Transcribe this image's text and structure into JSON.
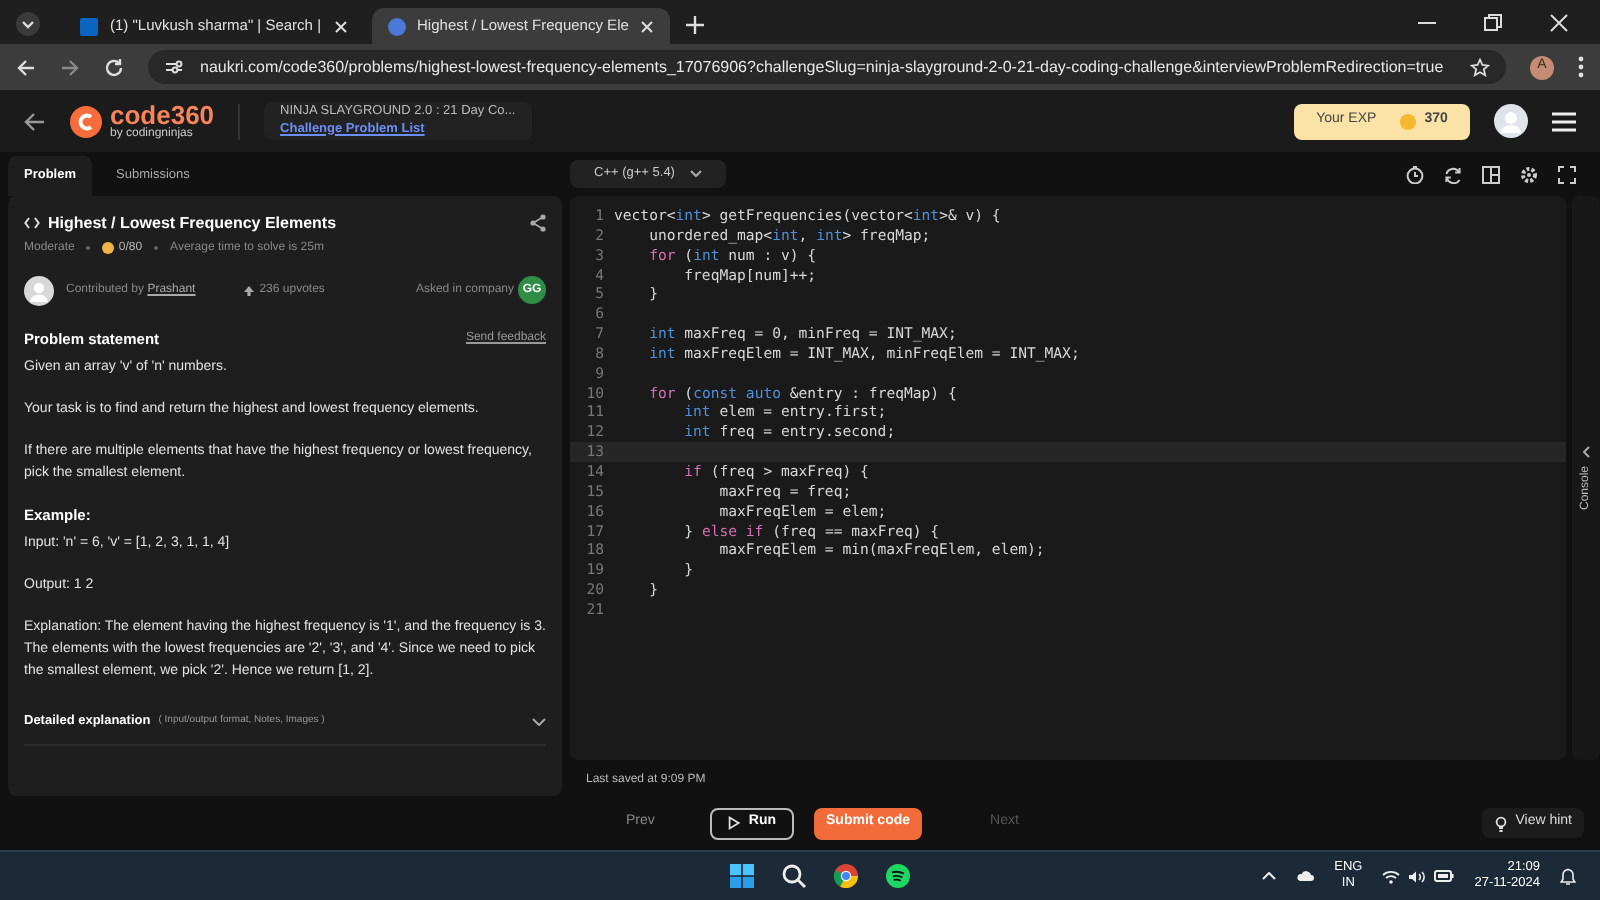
{
  "browser": {
    "tabs": [
      {
        "label": "(1) \"Luvkush sharma\" | Search |",
        "selected": false
      },
      {
        "label": "Highest / Lowest Frequency Ele",
        "selected": true
      }
    ],
    "url": "naukri.com/code360/problems/highest-lowest-frequency-elements_17076906?challengeSlug=ninja-slayground-2-0-21-day-coding-challenge&interviewProblemRedirection=true",
    "profile": "A"
  },
  "header": {
    "logo": "code360",
    "logo_sub": "by codingninjas",
    "contest": "NINJA SLAYGROUND 2.0 : 21 Day Co...",
    "contest_link": "Challenge Problem List",
    "exp_label": "Your EXP",
    "exp_value": "370"
  },
  "panel_tabs": [
    {
      "label": "Problem",
      "selected": true
    },
    {
      "label": "Submissions",
      "selected": false
    }
  ],
  "problem": {
    "title": "Highest / Lowest Frequency Elements",
    "difficulty": "Moderate",
    "score": "0/80",
    "avg_time": "Average time to solve is 25m",
    "contributed_by": "Contributed by",
    "contributor": "Prashant",
    "upvotes": "236 upvotes",
    "asked_in": "Asked in company",
    "company_badge": "GG",
    "statement_heading": "Problem statement",
    "feedback": "Send feedback",
    "paragraphs": [
      "Given an array 'v' of 'n' numbers.",
      "Your task is to find and return the highest and lowest frequency elements.",
      "If there are multiple elements that have the highest frequency or lowest frequency, pick the smallest element."
    ],
    "example_heading": "Example:",
    "example_lines": [
      "Input: 'n' = 6, 'v' = [1, 2, 3, 1, 1, 4]",
      "Output: 1 2",
      "Explanation: The element having the highest frequency is '1', and the frequency is 3. The elements with the lowest frequencies are '2', '3', and '4'. Since we need to pick the smallest element, we pick '2'. Hence we return [1, 2]."
    ],
    "detail_heading": "Detailed explanation",
    "detail_note": "( Input/output format, Notes, Images )"
  },
  "editor": {
    "language": "C++ (g++ 5.4)",
    "console": "Console",
    "last_saved": "Last saved at 9:09 PM",
    "lines": [
      {
        "number": "1",
        "current": false,
        "segments": [
          {
            "kind": "plain",
            "text": "vector<"
          },
          {
            "kind": "type",
            "text": "int"
          },
          {
            "kind": "plain",
            "text": "> getFrequencies(vector<"
          },
          {
            "kind": "type",
            "text": "int"
          },
          {
            "kind": "plain",
            "text": ">& v) {"
          }
        ]
      },
      {
        "number": "2",
        "current": false,
        "segments": [
          {
            "kind": "plain",
            "text": "    unordered_map<"
          },
          {
            "kind": "type",
            "text": "int"
          },
          {
            "kind": "plain",
            "text": ", "
          },
          {
            "kind": "type",
            "text": "int"
          },
          {
            "kind": "plain",
            "text": "> freqMap;"
          }
        ]
      },
      {
        "number": "3",
        "current": false,
        "segments": [
          {
            "kind": "ctrl",
            "text": "    for"
          },
          {
            "kind": "plain",
            "text": " ("
          },
          {
            "kind": "type",
            "text": "int"
          },
          {
            "kind": "plain",
            "text": " num : v) {"
          }
        ]
      },
      {
        "number": "4",
        "current": false,
        "segments": [
          {
            "kind": "plain",
            "text": "        freqMap[num]++;"
          }
        ]
      },
      {
        "number": "5",
        "current": false,
        "segments": [
          {
            "kind": "plain",
            "text": "    }"
          }
        ]
      },
      {
        "number": "6",
        "current": false
      },
      {
        "number": "7",
        "current": false,
        "segments": [
          {
            "kind": "type",
            "text": "    int"
          },
          {
            "kind": "plain",
            "text": " maxFreq = 0, minFreq = INT_MAX;"
          }
        ]
      },
      {
        "number": "8",
        "current": false,
        "segments": [
          {
            "kind": "type",
            "text": "    int"
          },
          {
            "kind": "plain",
            "text": " maxFreqElem = INT_MAX, minFreqElem = INT_MAX;"
          }
        ]
      },
      {
        "number": "9",
        "current": false
      },
      {
        "number": "10",
        "current": false,
        "segments": [
          {
            "kind": "ctrl",
            "text": "    for"
          },
          {
            "kind": "plain",
            "text": " ("
          },
          {
            "kind": "type",
            "text": "const auto"
          },
          {
            "kind": "plain",
            "text": " &entry : freqMap) {"
          }
        ]
      },
      {
        "number": "11",
        "current": false,
        "segments": [
          {
            "kind": "type",
            "text": "        int"
          },
          {
            "kind": "plain",
            "text": " elem = entry.first;"
          }
        ]
      },
      {
        "number": "12",
        "current": false,
        "segments": [
          {
            "kind": "type",
            "text": "        int"
          },
          {
            "kind": "plain",
            "text": " freq = entry.second;"
          }
        ]
      },
      {
        "number": "13",
        "current": true
      },
      {
        "number": "14",
        "current": false,
        "segments": [
          {
            "kind": "ctrl",
            "text": "        if"
          },
          {
            "kind": "plain",
            "text": " (freq > maxFreq) {"
          }
        ]
      },
      {
        "number": "15",
        "current": false,
        "segments": [
          {
            "kind": "plain",
            "text": "            maxFreq = freq;"
          }
        ]
      },
      {
        "number": "16",
        "current": false,
        "segments": [
          {
            "kind": "plain",
            "text": "            maxFreqElem = elem;"
          }
        ]
      },
      {
        "number": "17",
        "current": false,
        "segments": [
          {
            "kind": "plain",
            "text": "        } "
          },
          {
            "kind": "ctrl",
            "text": "else if"
          },
          {
            "kind": "plain",
            "text": " (freq == maxFreq) {"
          }
        ]
      },
      {
        "number": "18",
        "current": false,
        "segments": [
          {
            "kind": "plain",
            "text": "            maxFreqElem = min(maxFreqElem, elem);"
          }
        ]
      },
      {
        "number": "19",
        "current": false,
        "segments": [
          {
            "kind": "plain",
            "text": "        }"
          }
        ]
      },
      {
        "number": "20",
        "current": false,
        "segments": [
          {
            "kind": "plain",
            "text": "    }"
          }
        ]
      },
      {
        "number": "21",
        "current": false
      }
    ],
    "buttons": {
      "prev": "Prev",
      "run": "Run",
      "submit": "Submit code",
      "next": "Next",
      "hint": "View hint"
    }
  },
  "taskbar": {
    "lang": "ENG",
    "region": "IN",
    "time": "21:09",
    "date": "27-11-2024"
  }
}
